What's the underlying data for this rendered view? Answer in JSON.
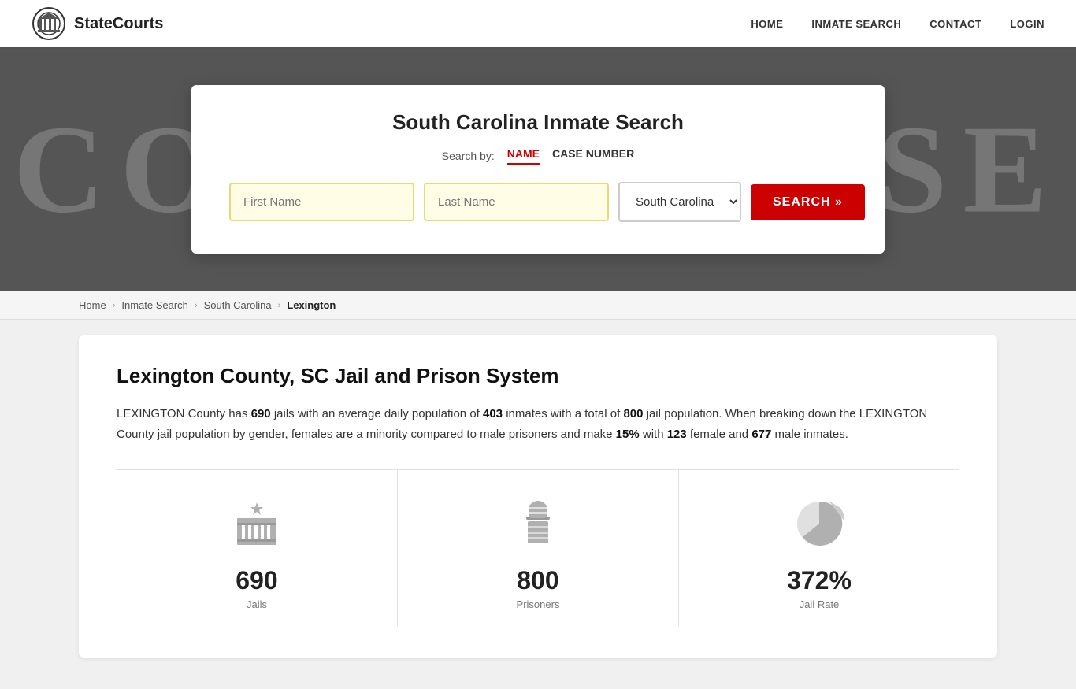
{
  "header": {
    "logo_text": "StateCourts",
    "nav": {
      "home": "HOME",
      "inmate_search": "INMATE SEARCH",
      "contact": "CONTACT",
      "login": "LOGIN"
    }
  },
  "hero": {
    "bg_text": "COURTHOUSE",
    "search_card": {
      "title": "South Carolina Inmate Search",
      "search_by_label": "Search by:",
      "tab_name": "NAME",
      "tab_case": "CASE NUMBER",
      "first_name_placeholder": "First Name",
      "last_name_placeholder": "Last Name",
      "state_value": "South Carolina",
      "search_btn": "SEARCH »"
    }
  },
  "breadcrumb": {
    "home": "Home",
    "inmate_search": "Inmate Search",
    "south_carolina": "South Carolina",
    "current": "Lexington"
  },
  "content": {
    "title": "Lexington County, SC Jail and Prison System",
    "paragraph_parts": {
      "intro": "LEXINGTON County has ",
      "jails": "690",
      "mid1": " jails with an average daily population of ",
      "avg_pop": "403",
      "mid2": " inmates with a total of ",
      "total_pop": "800",
      "mid3": " jail population. When breaking down the LEXINGTON County jail population by gender, females are a minority compared to male prisoners and make ",
      "female_pct": "15%",
      "mid4": " with ",
      "female_count": "123",
      "mid5": " female and ",
      "male_count": "677",
      "end": " male inmates."
    }
  },
  "stats": [
    {
      "id": "jails",
      "number": "690",
      "label": "Jails",
      "icon": "jail-icon"
    },
    {
      "id": "prisoners",
      "number": "800",
      "label": "Prisoners",
      "icon": "prisoner-icon"
    },
    {
      "id": "jail-rate",
      "number": "372%",
      "label": "Jail Rate",
      "icon": "chart-icon"
    }
  ]
}
